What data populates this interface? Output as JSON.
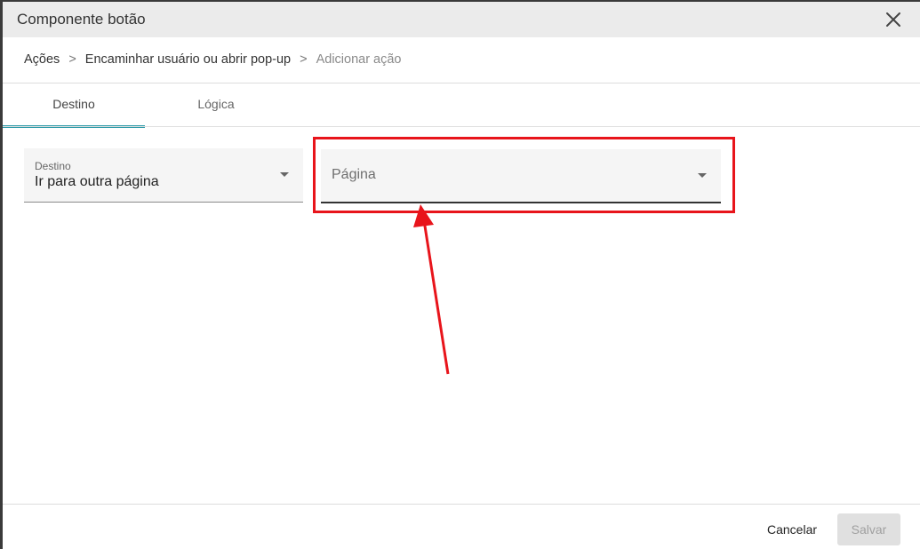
{
  "dialog": {
    "title": "Componente botão",
    "close_icon": "close-icon"
  },
  "breadcrumb": {
    "items": [
      "Ações",
      "Encaminhar usuário ou abrir pop-up",
      "Adicionar ação"
    ],
    "separator": ">"
  },
  "tabs": [
    {
      "label": "Destino",
      "active": true
    },
    {
      "label": "Lógica",
      "active": false
    }
  ],
  "form": {
    "destino": {
      "label": "Destino",
      "value": "Ir para outra página",
      "icon": "dropdown-arrow-icon"
    },
    "pagina": {
      "placeholder": "Página",
      "icon": "dropdown-arrow-icon"
    }
  },
  "annotation": {
    "highlight_color": "#e8141b"
  },
  "footer": {
    "cancel_label": "Cancelar",
    "save_label": "Salvar"
  },
  "colors": {
    "accent": "#2c9aa8",
    "title_bar": "#ebebeb"
  }
}
